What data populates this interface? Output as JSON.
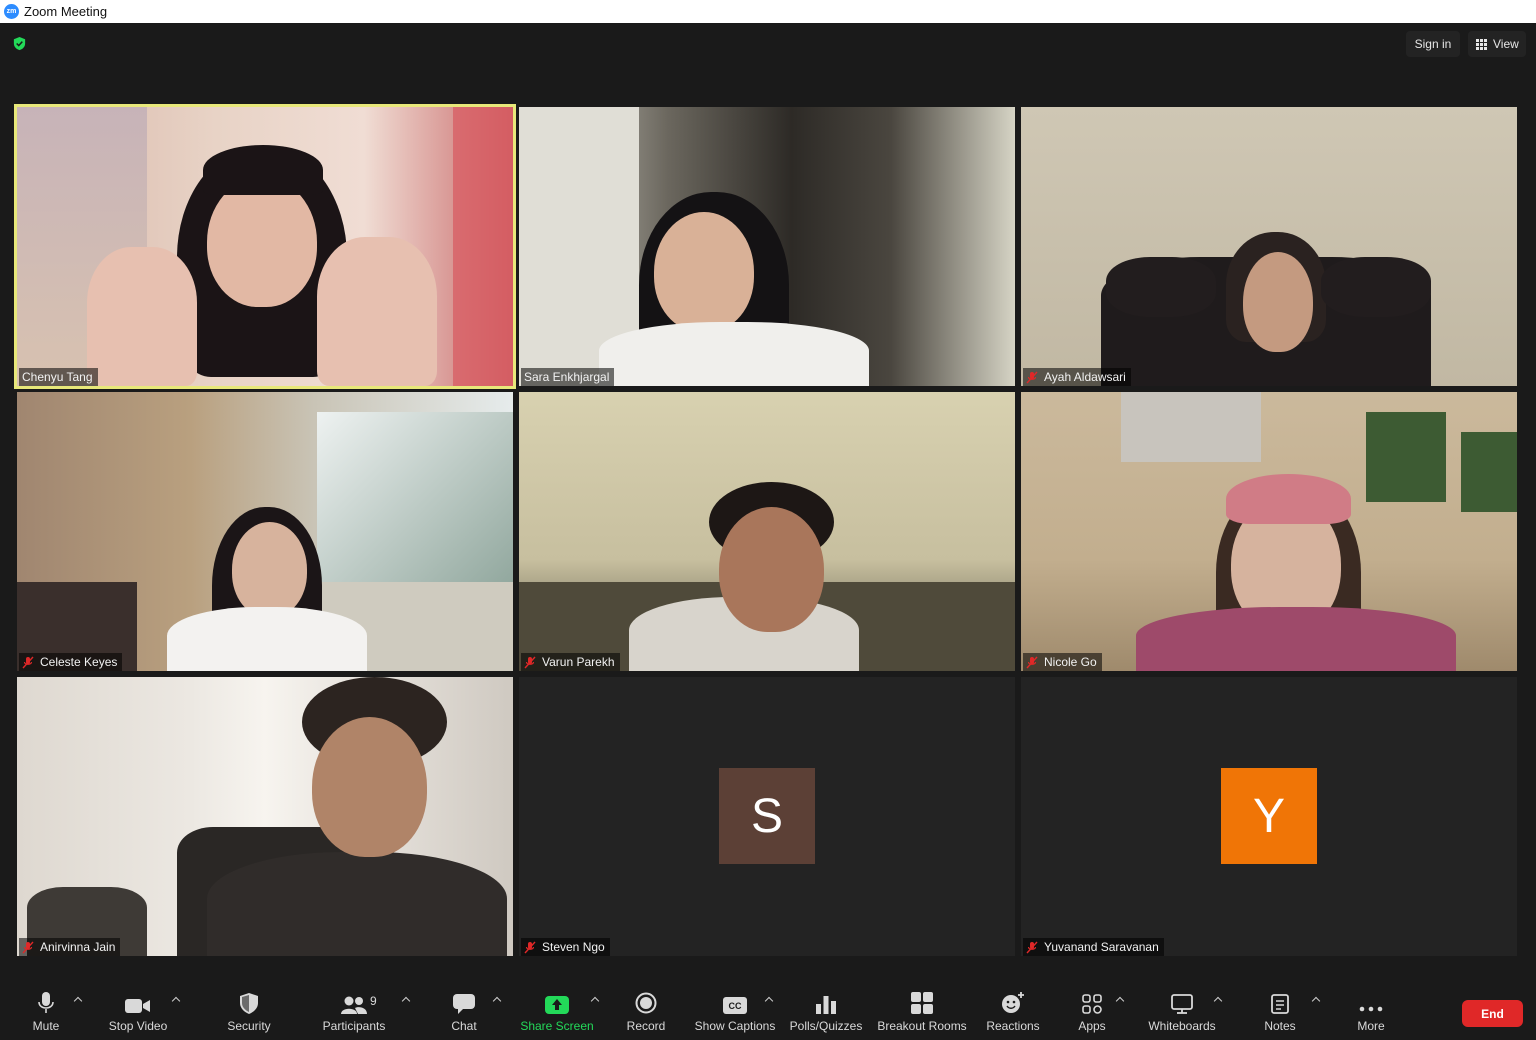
{
  "window": {
    "title": "Zoom Meeting",
    "logo_text": "zm"
  },
  "topbar": {
    "sign_in_label": "Sign in",
    "view_label": "View",
    "encryption_icon": "shield-check-icon",
    "accent_color": "#23d959"
  },
  "tiles": [
    {
      "name": "Chenyu Tang",
      "muted": false,
      "active_speaker": true,
      "video": true
    },
    {
      "name": "Sara Enkhjargal",
      "muted": false,
      "video": true
    },
    {
      "name": "Ayah Aldawsari",
      "muted": true,
      "video": true
    },
    {
      "name": "Celeste Keyes",
      "muted": true,
      "video": true
    },
    {
      "name": "Varun Parekh",
      "muted": true,
      "video": true
    },
    {
      "name": "Nicole Go",
      "muted": true,
      "video": true
    },
    {
      "name": "Anirvinna Jain",
      "muted": true,
      "video": true
    },
    {
      "name": "Steven Ngo",
      "muted": true,
      "video": false,
      "avatar_letter": "S",
      "avatar_color": "#5c4036"
    },
    {
      "name": "Yuvanand Saravanan",
      "muted": true,
      "video": false,
      "avatar_letter": "Y",
      "avatar_color": "#f07506"
    }
  ],
  "toolbar": {
    "mute": "Mute",
    "stop_video": "Stop Video",
    "security": "Security",
    "participants": "Participants",
    "participants_count": "9",
    "chat": "Chat",
    "share_screen": "Share Screen",
    "record": "Record",
    "show_captions": "Show Captions",
    "captions_icon_text": "CC",
    "polls": "Polls/Quizzes",
    "breakout": "Breakout Rooms",
    "reactions": "Reactions",
    "apps": "Apps",
    "whiteboards": "Whiteboards",
    "notes": "Notes",
    "more": "More",
    "end": "End",
    "end_color": "#e02828",
    "share_color": "#23d959"
  }
}
